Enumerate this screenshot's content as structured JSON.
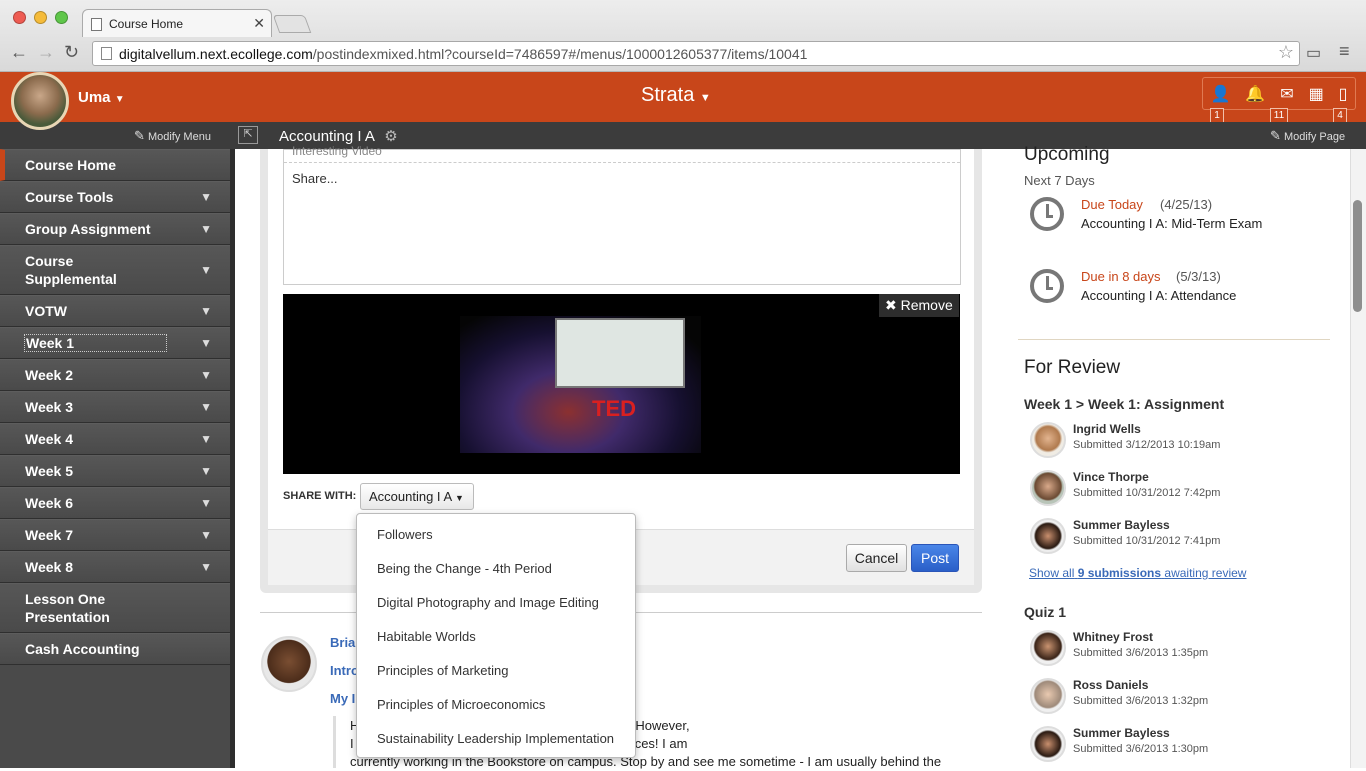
{
  "browser": {
    "tab_title": "Course Home",
    "url_host": "digitalvellum.next.ecollege.com",
    "url_path": "/postindexmixed.html?courseId=7486597#/menus/1000012605377/items/10041"
  },
  "header": {
    "user_name": "Uma",
    "app_name": "Strata",
    "badges": {
      "profile": "1",
      "mail": "11",
      "pages": "4"
    }
  },
  "subbar": {
    "modify_menu": "Modify Menu",
    "course_title": "Accounting I A",
    "modify_page": "Modify Page"
  },
  "sidebar": {
    "items": [
      {
        "label": "Course Home"
      },
      {
        "label": "Course Tools"
      },
      {
        "label": "Group Assignment"
      },
      {
        "label": "Course Supplemental"
      },
      {
        "label": "VOTW"
      },
      {
        "label": "Week 1"
      },
      {
        "label": "Week 2"
      },
      {
        "label": "Week 3"
      },
      {
        "label": "Week 4"
      },
      {
        "label": "Week 5"
      },
      {
        "label": "Week 6"
      },
      {
        "label": "Week 7"
      },
      {
        "label": "Week 8"
      },
      {
        "label": "Lesson One Presentation"
      },
      {
        "label": "Cash Accounting"
      }
    ]
  },
  "composer": {
    "previous_text": "Interesting Video",
    "placeholder": "Share...",
    "remove_label": "Remove",
    "video_text": "TED",
    "share_with_label": "SHARE WITH:",
    "share_with_value": "Accounting I A",
    "cancel_label": "Cancel",
    "post_label": "Post"
  },
  "share_options": [
    "Followers",
    "Being the Change - 4th Period",
    "Digital Photography and Image Editing",
    "Habitable Worlds",
    "Principles of Marketing",
    "Principles of Microeconomics",
    "Sustainability Leadership Implementation"
  ],
  "feed": {
    "author": "Brian",
    "line2": "Intro",
    "line3": "My I",
    "text1": "H major, and Accounting is a requirement for me.  However,",
    "text2": "I rhaps it can help me with my own personal finances!  I am",
    "text3": "currently working in the Bookstore on campus.  Stop by and see me sometime - I am usually behind the"
  },
  "upcoming": {
    "title": "Upcoming",
    "range": "Next 7 Days",
    "events": [
      {
        "due": "Due Today",
        "date": "(4/25/13)",
        "name": "Accounting I A: Mid-Term Exam"
      },
      {
        "due": "Due in 8 days",
        "date": "(5/3/13)",
        "name": "Accounting I A: Attendance"
      }
    ]
  },
  "review": {
    "title": "For Review",
    "group1": "Week 1 > Week 1: Assignment",
    "group1_items": [
      {
        "name": "Ingrid Wells",
        "date": "Submitted 3/12/2013 10:19am"
      },
      {
        "name": "Vince Thorpe",
        "date": "Submitted 10/31/2012 7:42pm"
      },
      {
        "name": "Summer Bayless",
        "date": "Submitted 10/31/2012 7:41pm"
      }
    ],
    "show_all_pre": "Show all",
    "show_all_count": "9 submissions",
    "show_all_post": "awaiting review",
    "group2": "Quiz 1",
    "group2_items": [
      {
        "name": "Whitney Frost",
        "date": "Submitted 3/6/2013 1:35pm"
      },
      {
        "name": "Ross Daniels",
        "date": "Submitted 3/6/2013 1:32pm"
      },
      {
        "name": "Summer Bayless",
        "date": "Submitted 3/6/2013 1:30pm"
      }
    ]
  },
  "colors": {
    "brand": "#c8461a",
    "link": "#3a6ab8",
    "post": "#2a5fc8"
  }
}
